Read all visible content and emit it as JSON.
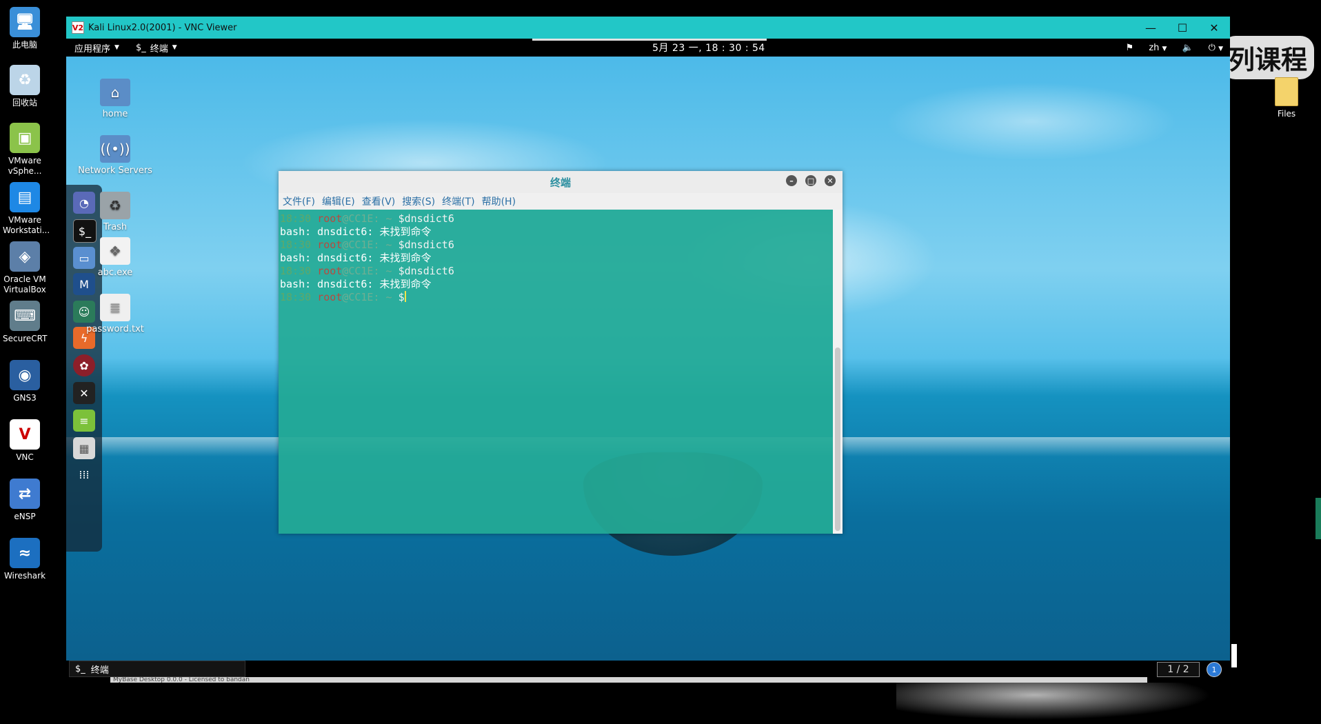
{
  "host": {
    "desktop_icons": [
      {
        "label": "此电脑",
        "icon": "computer-icon"
      },
      {
        "label": "回收站",
        "icon": "recycle-bin-icon"
      },
      {
        "label": "VMware vSphe...",
        "icon": "vmware-vsphere-icon"
      },
      {
        "label": "VMware Workstati...",
        "icon": "vmware-workstation-icon"
      },
      {
        "label": "Oracle VM VirtualBox",
        "icon": "virtualbox-icon"
      },
      {
        "label": "SecureCRT",
        "icon": "securecrt-icon"
      },
      {
        "label": "GNS3",
        "icon": "gns3-icon"
      },
      {
        "label": "VNC",
        "icon": "vnc-icon"
      },
      {
        "label": "eNSP",
        "icon": "ensp-icon"
      },
      {
        "label": "Wireshark",
        "icon": "wireshark-icon"
      }
    ],
    "right_banner": "列课程",
    "files_label": "Files",
    "bottom_strip_text": "MyBase Desktop 0.0.0 - Licensed to bandan"
  },
  "vnc": {
    "title": "Kali Linux2.0(2001) - VNC Viewer",
    "logo_text": "V2",
    "controls": {
      "minimize": "—",
      "maximize": "☐",
      "close": "✕"
    }
  },
  "kali": {
    "panel": {
      "apps_menu": "应用程序",
      "terminal_menu": "终端",
      "terminal_menu_prefix": "$_",
      "clock": "5月 23 一, 18 : 30 : 54",
      "lang": "zh"
    },
    "desktop_icons": [
      {
        "label": "home",
        "icon": "home-folder-icon"
      },
      {
        "label": "Network Servers",
        "icon": "network-servers-icon"
      },
      {
        "label": "Trash",
        "icon": "trash-icon"
      },
      {
        "label": "abc.exe",
        "icon": "exe-file-icon"
      },
      {
        "label": "password.txt",
        "icon": "text-file-icon"
      }
    ],
    "dock": [
      "iceweasel-icon",
      "terminal-icon",
      "files-icon",
      "metasploit-icon",
      "armitage-icon",
      "burpsuite-icon",
      "maltego-icon",
      "beef-icon",
      "leafpad-icon",
      "cherrytree-icon",
      "show-apps-icon"
    ],
    "terminal": {
      "title": "终端",
      "menu": [
        "文件(F)",
        "编辑(E)",
        "查看(V)",
        "搜索(S)",
        "终端(T)",
        "帮助(H)"
      ],
      "lines": [
        {
          "type": "prompt",
          "time": "18:30",
          "user": "root",
          "host": "@CC1E:",
          "path": "~",
          "cmd": "$dnsdict6"
        },
        {
          "type": "output",
          "text": "bash: dnsdict6: 未找到命令"
        },
        {
          "type": "prompt",
          "time": "18:30",
          "user": "root",
          "host": "@CC1E:",
          "path": "~",
          "cmd": "$dnsdict6"
        },
        {
          "type": "output",
          "text": "bash: dnsdict6: 未找到命令"
        },
        {
          "type": "prompt",
          "time": "18:30",
          "user": "root",
          "host": "@CC1E:",
          "path": "~",
          "cmd": "$dnsdict6"
        },
        {
          "type": "output",
          "text": "bash: dnsdict6: 未找到命令"
        },
        {
          "type": "prompt",
          "time": "18:30",
          "user": "root",
          "host": "@CC1E:",
          "path": "~",
          "cmd": "$"
        }
      ]
    },
    "taskbar": {
      "task_label": "终端",
      "pager": "1 / 2",
      "notif": "1"
    }
  }
}
